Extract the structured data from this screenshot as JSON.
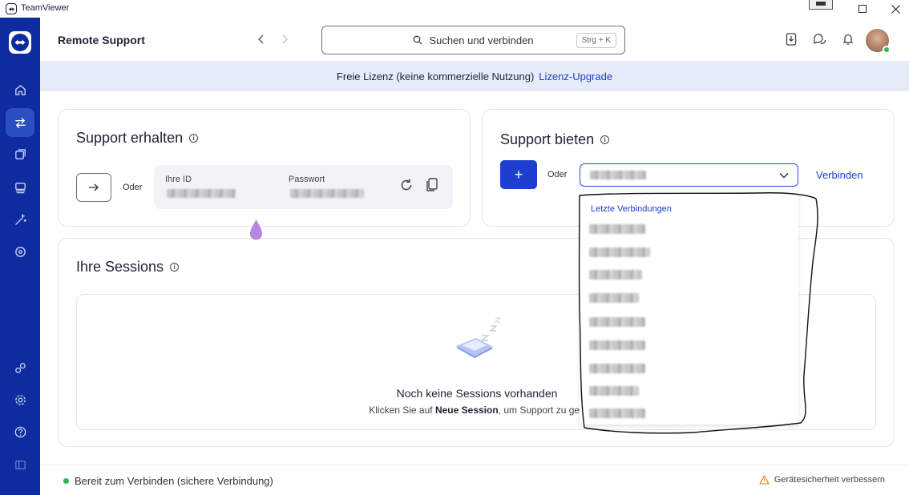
{
  "window": {
    "title": "TeamViewer"
  },
  "header": {
    "title": "Remote Support",
    "search_placeholder": "Suchen und verbinden",
    "search_shortcut": "Strg + K"
  },
  "banner": {
    "text": "Freie Lizenz (keine kommerzielle Nutzung)",
    "link": "Lizenz-Upgrade"
  },
  "get_support": {
    "title": "Support erhalten",
    "or_label": "Oder",
    "id_label": "Ihre ID",
    "password_label": "Passwort"
  },
  "give_support": {
    "title": "Support bieten",
    "or_label": "Oder",
    "connect_label": "Verbinden",
    "plus_label": "+"
  },
  "sessions": {
    "title": "Ihre Sessions",
    "empty_title": "Noch keine Sessions vorhanden",
    "empty_sub_prefix": "Klicken Sie auf",
    "empty_sub_bold": "Neue Session",
    "empty_sub_suffix": ", um Support zu geb"
  },
  "dropdown": {
    "header": "Letzte Verbindungen",
    "items": [
      "",
      "",
      "",
      "",
      "",
      "",
      "",
      "",
      ""
    ]
  },
  "status": {
    "text": "Bereit zum Verbinden (sichere Verbindung)",
    "security": "Gerätesicherheit verbessern"
  },
  "colors": {
    "sidebar": "#0e2ba0",
    "accent": "#1c3fcf",
    "banner": "#e6ebfa",
    "online": "#2fb84a"
  }
}
